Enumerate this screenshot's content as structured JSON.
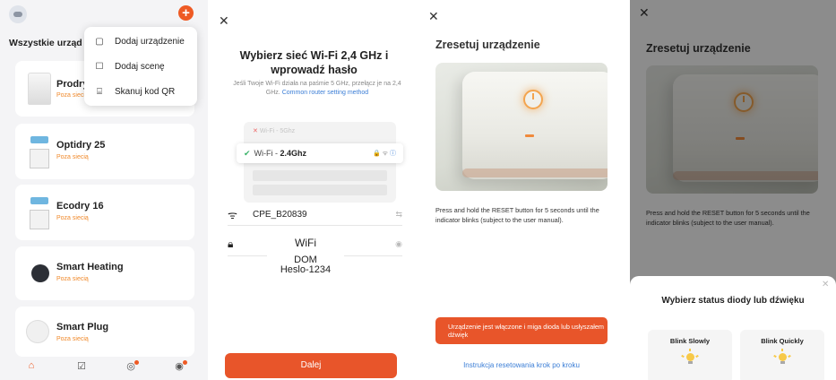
{
  "panel1": {
    "title": "Wszystkie urząd",
    "menu": [
      {
        "icon": "add-device-icon",
        "label": "Dodaj urządzenie"
      },
      {
        "icon": "add-scene-icon",
        "label": "Dodaj scenę"
      },
      {
        "icon": "scan-qr-icon",
        "label": "Skanuj kod QR"
      }
    ],
    "devices": [
      {
        "name": "Prodry",
        "status": "Poza siecią"
      },
      {
        "name": "Optidry 25",
        "status": "Poza siecią"
      },
      {
        "name": "Ecodry 16",
        "status": "Poza siecią"
      },
      {
        "name": "Smart Heating",
        "status": "Poza siecią"
      },
      {
        "name": "Smart Plug",
        "status": "Poza siecią"
      }
    ],
    "tabs": [
      "home-icon",
      "tasks-icon",
      "scene-icon",
      "profile-icon"
    ],
    "accent": "#ee5a24"
  },
  "panel2": {
    "title": "Wybierz sieć Wi-Fi 2,4 GHz i wprowadź hasło",
    "desc": "Jeśli Twoje Wi-Fi działa na paśmie 5 GHz, przełącz je na 2,4 GHz.",
    "desc_link": "Common router setting method",
    "wifi_5g": "Wi-Fi - 5Ghz",
    "wifi_24_prefix": "Wi-Fi - ",
    "wifi_24_bold": "2.4Ghz",
    "ssid": "CPE_B20839",
    "overlay_wifi": "WiFi",
    "overlay_dom": "DOM",
    "overlay_pass": "Heslo-1234",
    "next": "Dalej"
  },
  "panel3": {
    "title": "Zresetuj urządzenie",
    "desc": "Press and hold the RESET button for 5 seconds until the indicator blinks (subject to the user manual).",
    "confirm": "Urządzenie jest włączone i miga dioda lub usłyszałem dźwięk",
    "link": "Instrukcja resetowania krok po kroku"
  },
  "panel4": {
    "title": "Zresetuj urządzenie",
    "desc": "Press and hold the RESET button for 5 seconds until the indicator blinks (subject to the user manual).",
    "sheet_title": "Wybierz status diody lub dźwięku",
    "options": [
      "Blink Slowly",
      "Blink Quickly"
    ]
  }
}
